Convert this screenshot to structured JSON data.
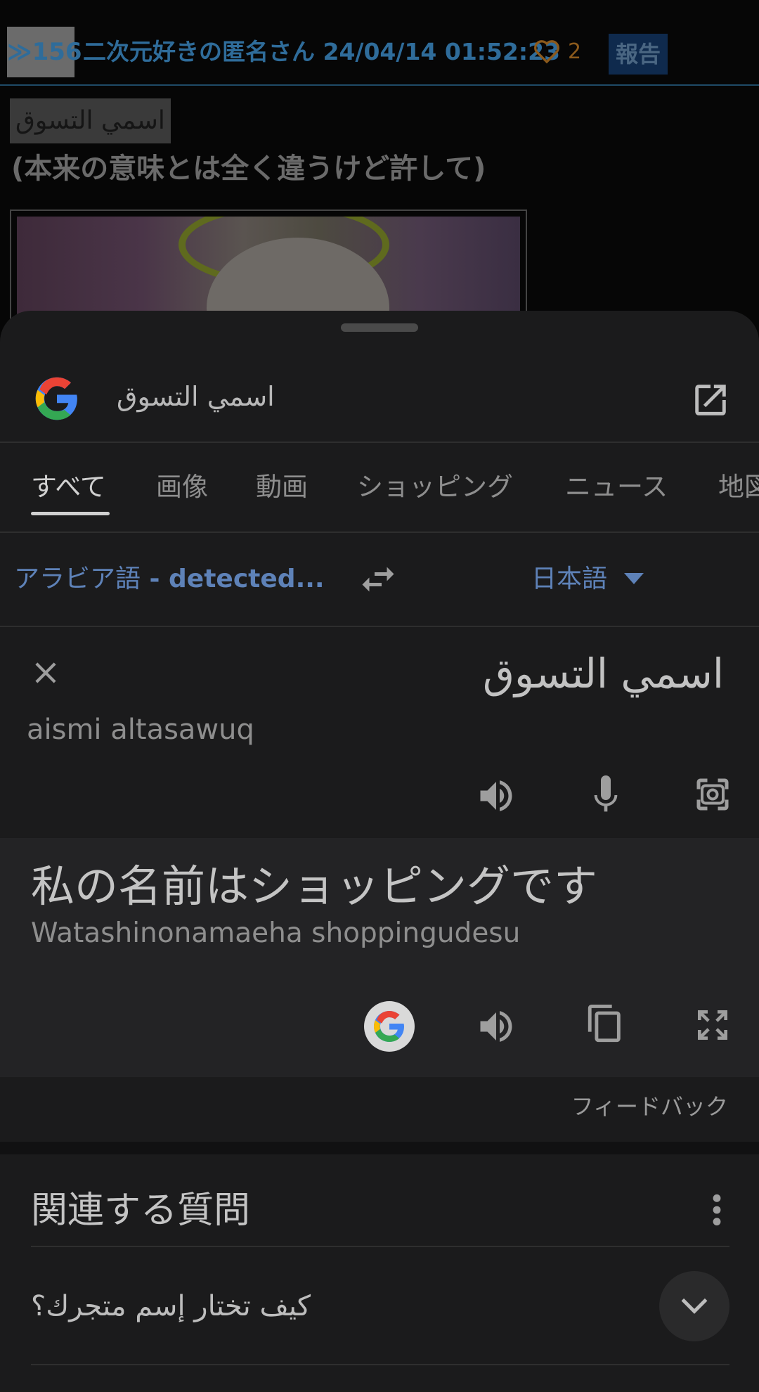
{
  "background_post": {
    "reply_number": "≫156",
    "poster": "二次元好きの匿名さん 24/04/14 01:52:23",
    "like_count": "2",
    "report_label": "報告",
    "highlighted_text": "اسمي التسوق",
    "body_line": "(本来の意味とは全く違うけど許して)"
  },
  "search": {
    "query": "اسمي التسوق"
  },
  "tabs": [
    {
      "label": "すべて",
      "active": true
    },
    {
      "label": "画像"
    },
    {
      "label": "動画"
    },
    {
      "label": "ショッピング"
    },
    {
      "label": "ニュース"
    },
    {
      "label": "地図"
    }
  ],
  "translate": {
    "source_lang": "アラビア語",
    "source_detected": " - detected...",
    "target_lang": "日本語",
    "source_text": "اسمي التسوق",
    "source_transliteration": "aismi altasawuq",
    "result_text": "私の名前はショッピングです",
    "result_transliteration": "Watashinonamaeha shoppingudesu",
    "feedback_label": "フィードバック"
  },
  "related": {
    "title": "関連する質問",
    "questions": [
      "كيف تختار إسم متجرك؟"
    ]
  },
  "colors": {
    "accent_blue": "#5e82b8",
    "sheet_bg": "#1b1b1c",
    "result_bg": "#232325"
  }
}
